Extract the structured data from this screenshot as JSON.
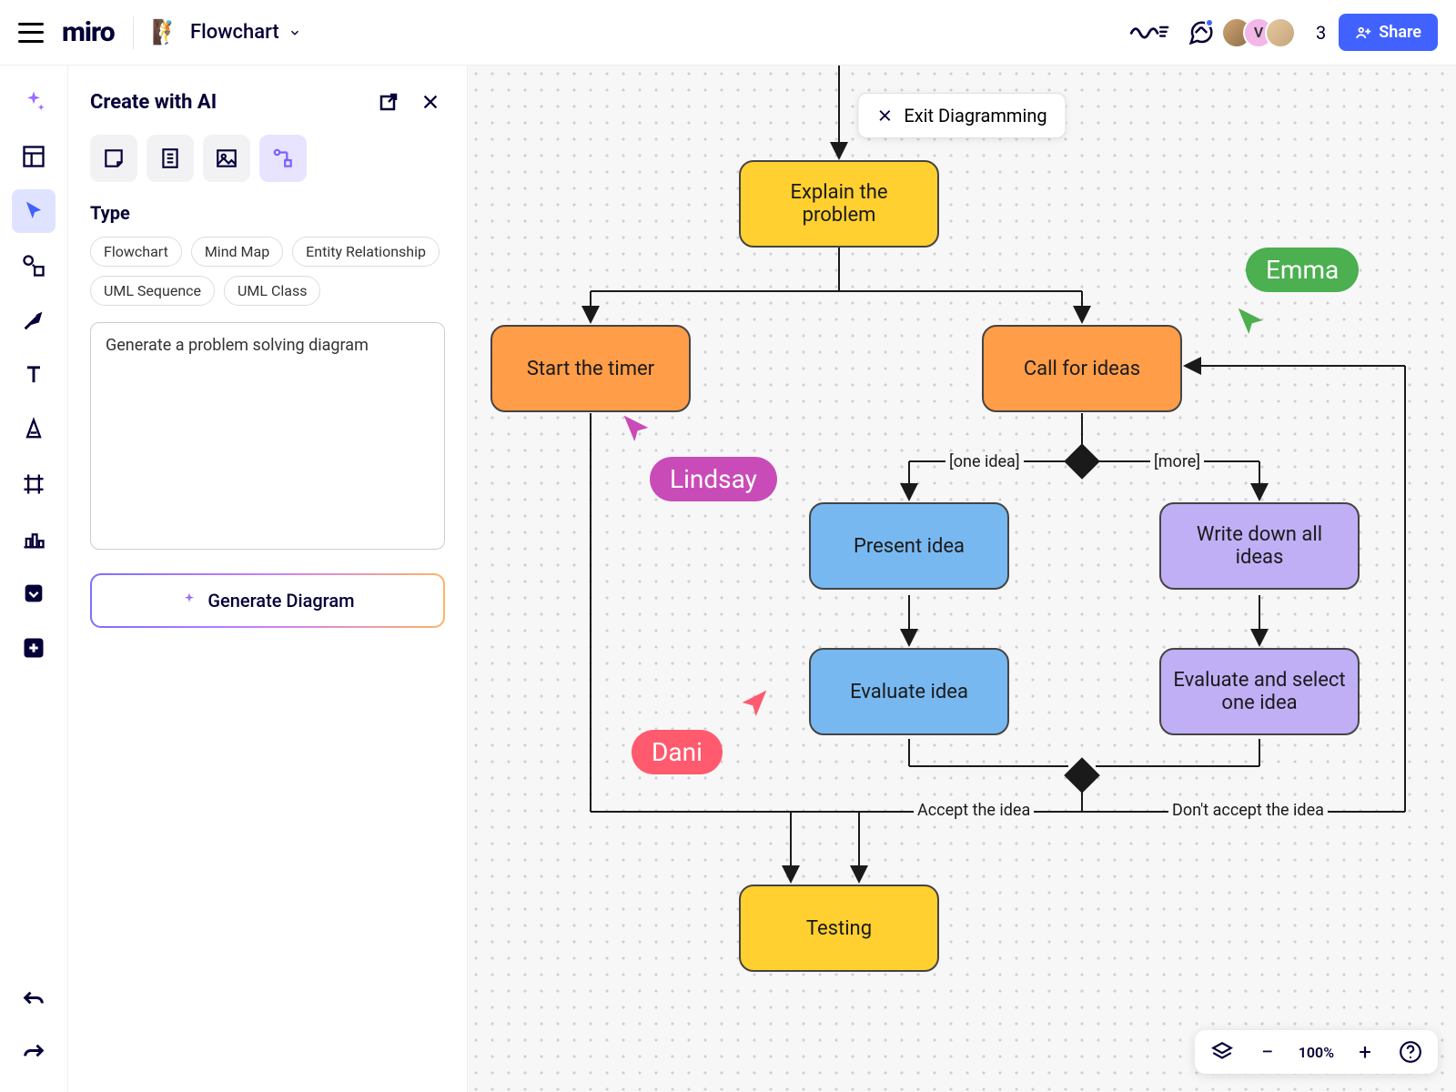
{
  "header": {
    "logo": "miro",
    "board_emoji": "🧗",
    "board_title": "Flowchart",
    "presence_count": "3",
    "avatars": [
      {
        "bg": "av1",
        "label": ""
      },
      {
        "bg": "av2",
        "label": "V"
      },
      {
        "bg": "av3",
        "label": ""
      }
    ],
    "share_label": "Share"
  },
  "sidepanel": {
    "title": "Create with AI",
    "type_label": "Type",
    "chips": [
      "Flowchart",
      "Mind Map",
      "Entity Relationship",
      "UML Sequence",
      "UML Class"
    ],
    "prompt_value": "Generate a problem solving diagram",
    "generate_label": "Generate Diagram"
  },
  "canvas": {
    "exit_label": "Exit Diagramming",
    "nodes": {
      "explain": "Explain the problem",
      "start_timer": "Start the timer",
      "call_ideas": "Call for ideas",
      "present": "Present idea",
      "writedown": "Write down all ideas",
      "evaluate1": "Evaluate idea",
      "evaluate2": "Evaluate and select one idea",
      "testing": "Testing"
    },
    "edge_labels": {
      "one_idea": "[one idea]",
      "more": "[more]",
      "accept": "Accept the idea",
      "dont_accept": "Don't accept the idea"
    },
    "collaborators": {
      "emma": "Emma",
      "lindsay": "Lindsay",
      "dani": "Dani"
    }
  },
  "bottom": {
    "zoom": "100%"
  }
}
